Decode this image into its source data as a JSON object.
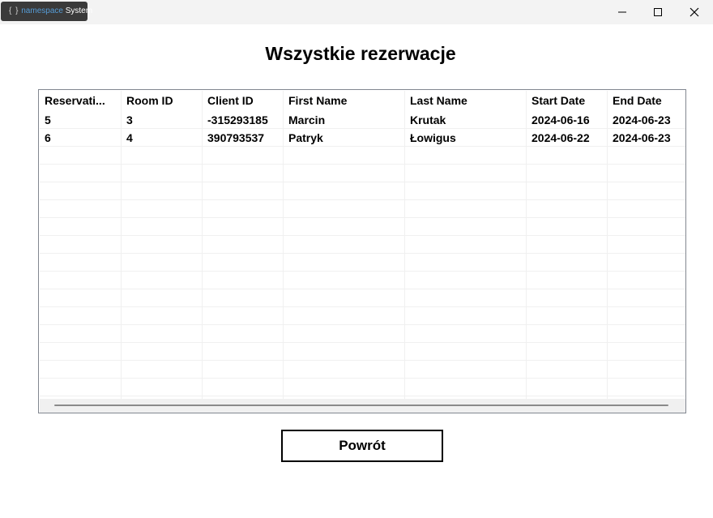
{
  "window": {
    "app_badge": {
      "braces": "{ }",
      "namespace": "namespace",
      "system": "System"
    },
    "controls": {
      "minimize_icon": "minimize-icon",
      "maximize_icon": "maximize-icon",
      "close_icon": "close-icon"
    }
  },
  "page": {
    "title": "Wszystkie rezerwacje"
  },
  "table": {
    "headers": [
      "Reservati...",
      "Room ID",
      "Client ID",
      "First Name",
      "Last Name",
      "Start Date",
      "End Date"
    ],
    "rows": [
      [
        "5",
        "3",
        "-315293185",
        "Marcin",
        "Krutak",
        "2024-06-16",
        "2024-06-23"
      ],
      [
        "6",
        "4",
        "390793537",
        "Patryk",
        "Łowigus",
        "2024-06-22",
        "2024-06-23"
      ]
    ]
  },
  "back_button": {
    "label": "Powrót"
  }
}
